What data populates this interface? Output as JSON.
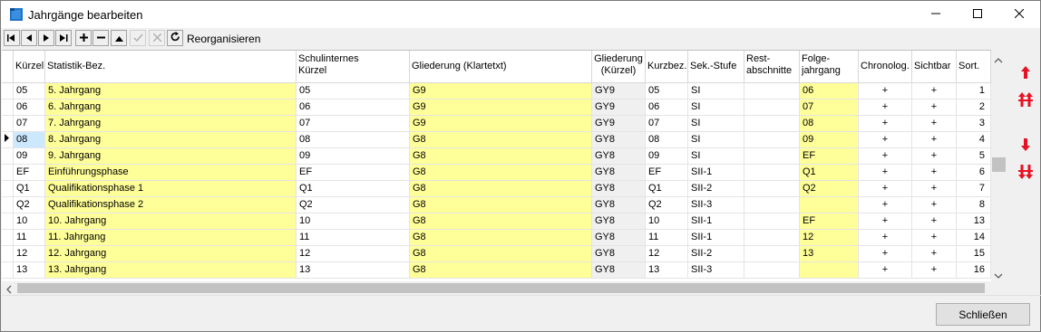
{
  "window": {
    "title": "Jahrgänge bearbeiten"
  },
  "toolbar": {
    "reorganize_label": "Reorganisieren"
  },
  "table": {
    "headers": {
      "kuerzel": "Kürzel",
      "statistik": "Statistik-Bez.",
      "schulintern_1": "Schulinternes",
      "schulintern_2": "Kürzel",
      "gliederung_klartext": "Gliederung (Klartetxt)",
      "gliederung_kurz_1": "Gliederung",
      "gliederung_kurz_2": "(Kürzel)",
      "kurzbez": "Kurzbez.",
      "sekstufe": "Sek.-Stufe",
      "rest_1": "Rest-",
      "rest_2": "abschnitte",
      "folge_1": "Folge-",
      "folge_2": "jahrgang",
      "chronolog": "Chronolog.",
      "sichtbar": "Sichtbar",
      "sort": "Sort."
    },
    "rows": [
      {
        "kuerzel": "05",
        "statistik": " 5. Jahrgang",
        "schulintern": "05",
        "gliederung": "G9",
        "gliederung_kurz": "GY9",
        "kurzbez": "05",
        "sekstufe": "SI",
        "rest": "",
        "folge": "06",
        "chronolog": "+",
        "sichtbar": "+",
        "sort": "1"
      },
      {
        "kuerzel": "06",
        "statistik": " 6. Jahrgang",
        "schulintern": "06",
        "gliederung": "G9",
        "gliederung_kurz": "GY9",
        "kurzbez": "06",
        "sekstufe": "SI",
        "rest": "",
        "folge": "07",
        "chronolog": "+",
        "sichtbar": "+",
        "sort": "2"
      },
      {
        "kuerzel": "07",
        "statistik": " 7. Jahrgang",
        "schulintern": "07",
        "gliederung": "G9",
        "gliederung_kurz": "GY9",
        "kurzbez": "07",
        "sekstufe": "SI",
        "rest": "",
        "folge": "08",
        "chronolog": "+",
        "sichtbar": "+",
        "sort": "3"
      },
      {
        "kuerzel": "08",
        "statistik": " 8. Jahrgang",
        "schulintern": "08",
        "gliederung": "G8",
        "gliederung_kurz": "GY8",
        "kurzbez": "08",
        "sekstufe": "SI",
        "rest": "",
        "folge": "09",
        "chronolog": "+",
        "sichtbar": "+",
        "sort": "4",
        "selected": true
      },
      {
        "kuerzel": "09",
        "statistik": " 9. Jahrgang",
        "schulintern": "09",
        "gliederung": "G8",
        "gliederung_kurz": "GY8",
        "kurzbez": "09",
        "sekstufe": "SI",
        "rest": "",
        "folge": "EF",
        "chronolog": "+",
        "sichtbar": "+",
        "sort": "5"
      },
      {
        "kuerzel": "EF",
        "statistik": "Einführungsphase",
        "schulintern": "EF",
        "gliederung": "G8",
        "gliederung_kurz": "GY8",
        "kurzbez": "EF",
        "sekstufe": "SII-1",
        "rest": "",
        "folge": "Q1",
        "chronolog": "+",
        "sichtbar": "+",
        "sort": "6"
      },
      {
        "kuerzel": "Q1",
        "statistik": "Qualifikationsphase 1",
        "schulintern": "Q1",
        "gliederung": "G8",
        "gliederung_kurz": "GY8",
        "kurzbez": "Q1",
        "sekstufe": "SII-2",
        "rest": "",
        "folge": "Q2",
        "chronolog": "+",
        "sichtbar": "+",
        "sort": "7"
      },
      {
        "kuerzel": "Q2",
        "statistik": "Qualifikationsphase 2",
        "schulintern": "Q2",
        "gliederung": "G8",
        "gliederung_kurz": "GY8",
        "kurzbez": "Q2",
        "sekstufe": "SII-3",
        "rest": "",
        "folge": "",
        "chronolog": "+",
        "sichtbar": "+",
        "sort": "8"
      },
      {
        "kuerzel": "10",
        "statistik": "10. Jahrgang",
        "schulintern": "10",
        "gliederung": "G8",
        "gliederung_kurz": "GY8",
        "kurzbez": "10",
        "sekstufe": "SII-1",
        "rest": "",
        "folge": "EF",
        "chronolog": "+",
        "sichtbar": "+",
        "sort": "13"
      },
      {
        "kuerzel": "11",
        "statistik": "11. Jahrgang",
        "schulintern": "11",
        "gliederung": "G8",
        "gliederung_kurz": "GY8",
        "kurzbez": "11",
        "sekstufe": "SII-1",
        "rest": "",
        "folge": "12",
        "chronolog": "+",
        "sichtbar": "+",
        "sort": "14"
      },
      {
        "kuerzel": "12",
        "statistik": "12. Jahrgang",
        "schulintern": "12",
        "gliederung": "G8",
        "gliederung_kurz": "GY8",
        "kurzbez": "12",
        "sekstufe": "SII-2",
        "rest": "",
        "folge": "13",
        "chronolog": "+",
        "sichtbar": "+",
        "sort": "15"
      },
      {
        "kuerzel": "13",
        "statistik": "13. Jahrgang",
        "schulintern": "13",
        "gliederung": "G8",
        "gliederung_kurz": "GY8",
        "kurzbez": "13",
        "sekstufe": "SII-3",
        "rest": "",
        "folge": "",
        "chronolog": "+",
        "sichtbar": "+",
        "sort": "16"
      }
    ]
  },
  "footer": {
    "close_label": "Schließen"
  },
  "colors": {
    "editable_cell": "#ffff99",
    "selected_cell": "#cce8ff",
    "move_arrow": "#e81123"
  }
}
